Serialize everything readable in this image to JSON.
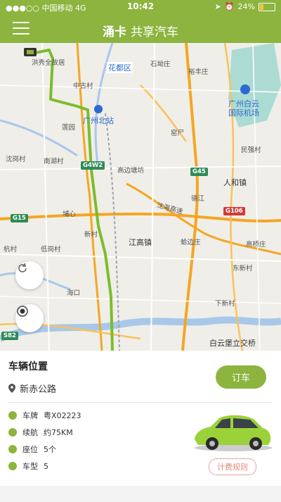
{
  "status_bar": {
    "carrier": "中国移动",
    "network": "4G",
    "time": "10:42",
    "battery": "24%"
  },
  "header": {
    "logo_text": "涌卡",
    "title": "共享汽车"
  },
  "map": {
    "labels": {
      "hongxiu": "洪秀全故居",
      "huadu": "花都区",
      "guangzhou_north": "广州北站",
      "baiyun_airport": "广州白云\n国际机场",
      "jianggao": "江高镇",
      "renhe": "人和镇",
      "baiyun_castle": "白云堡立交桥",
      "shiling": "石坳庄",
      "yushou": "裕丰庄",
      "yaokou": "窑尸",
      "gaobian": "高边塘坊",
      "shanlu": "沈海高速",
      "lianhe": "莲园",
      "nanhu": "南湖村",
      "shengang": "沈岗村",
      "zhonggu": "中古村",
      "yexin": "埔心",
      "hainan": "海口",
      "mincun": "民强村",
      "gaoqiao": "高桥庄",
      "dongxin": "东新村",
      "xiaci": "下新村",
      "diqi": "低岗村",
      "dejiang": "德江",
      "ganhe": "杭村",
      "xianhe": "新村",
      "lingtou": "蛤边庄"
    },
    "shields": {
      "g15": "G15",
      "g45": "G45",
      "g4w2": "G4W2",
      "g106": "G106",
      "s82": "S82"
    }
  },
  "panel": {
    "title": "车辆位置",
    "location": "新赤公路",
    "order_label": "订车",
    "plate_label": "车牌",
    "plate_value": "粤X02223",
    "range_label": "续航",
    "range_value": "约75KM",
    "seats_label": "座位",
    "seats_value": "5个",
    "type_label": "车型",
    "type_value": "5",
    "rules_label": "计费规则"
  },
  "colors": {
    "brand_green": "#8cb43e",
    "route_green": "#7bbd2b",
    "highway_orange": "#f5a623"
  }
}
